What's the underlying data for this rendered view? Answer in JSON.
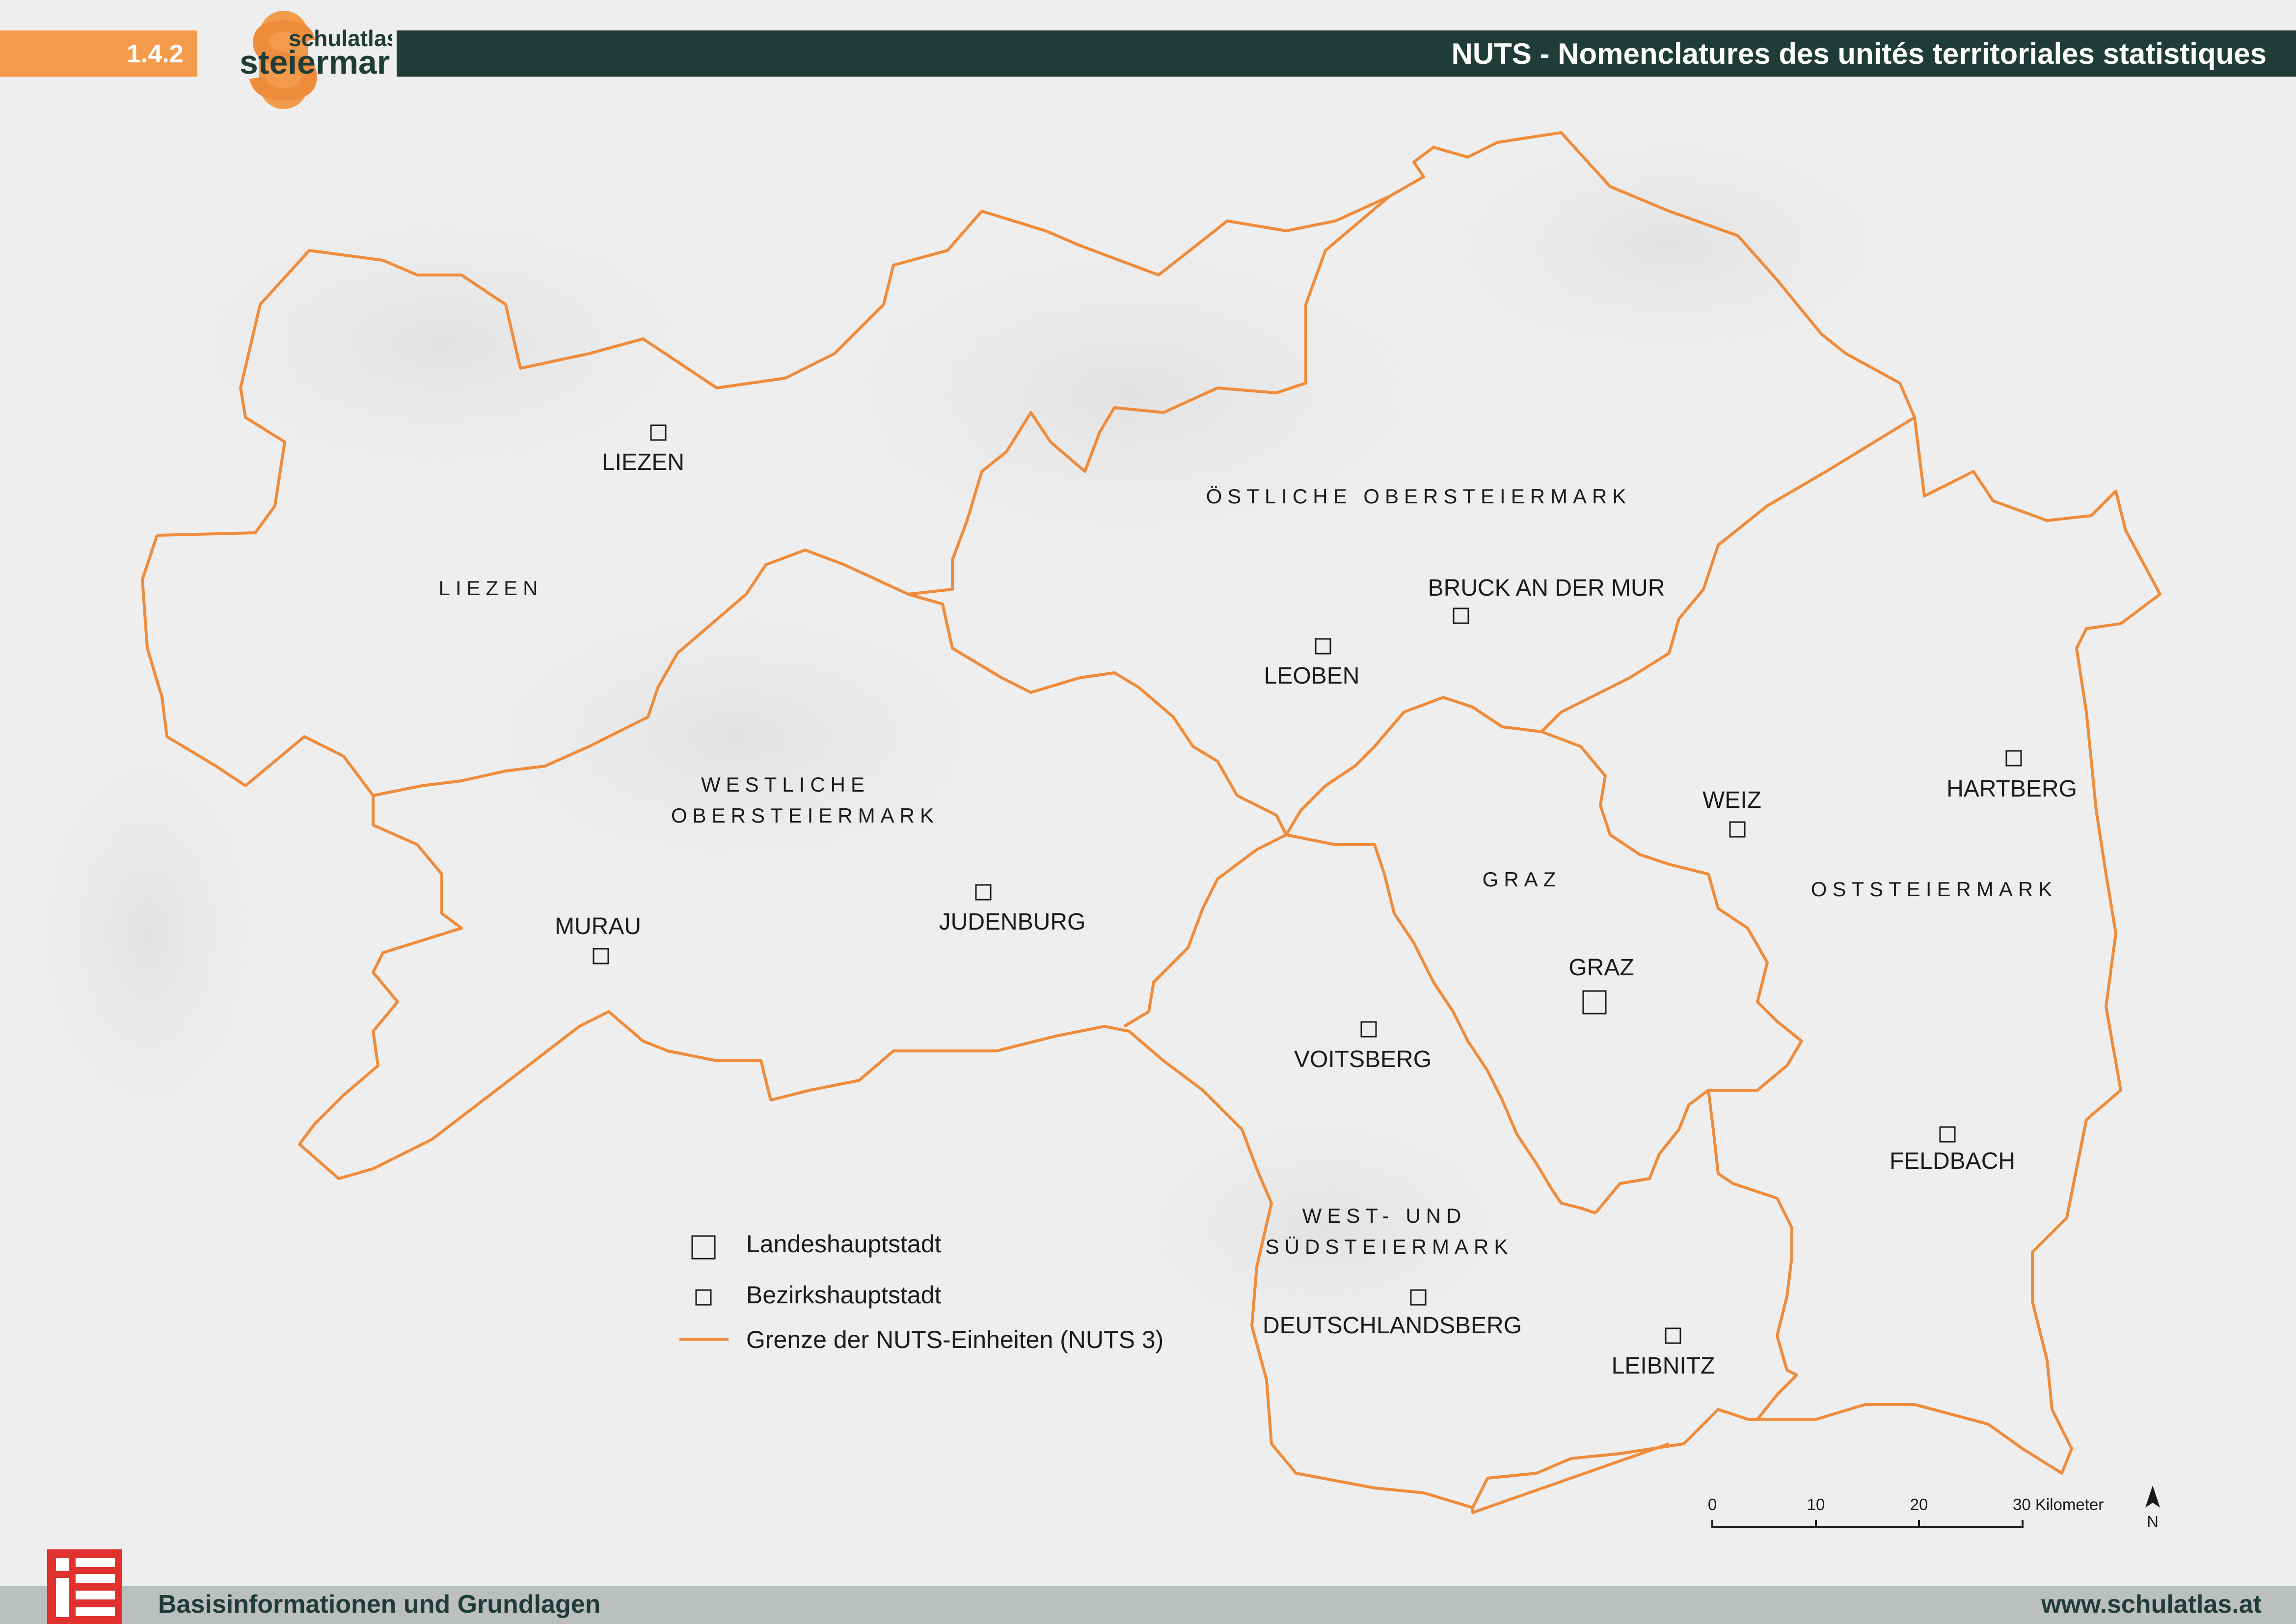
{
  "header": {
    "section_number": "1.4.2",
    "logo_top": "schulatlas",
    "logo_main": "steiermark",
    "title": "NUTS - Nomenclatures des unités territoriales statistiques"
  },
  "footer": {
    "left": "Basisinformationen und Grundlagen",
    "right": "www.schulatlas.at"
  },
  "regions": {
    "liezen": "LIEZEN",
    "oestliche": "ÖSTLICHE OBERSTEIERMARK",
    "westliche_1": "WESTLICHE",
    "westliche_2": "OBERSTEIERMARK",
    "graz": "GRAZ",
    "oststeiermark": "OSTSTEIERMARK",
    "west_sued_1": "WEST- UND",
    "west_sued_2": "SÜDSTEIERMARK"
  },
  "cities": {
    "liezen": "LIEZEN",
    "bruck": "BRUCK AN DER MUR",
    "leoben": "LEOBEN",
    "murau": "MURAU",
    "judenburg": "JUDENBURG",
    "weiz": "WEIZ",
    "hartberg": "HARTBERG",
    "graz": "GRAZ",
    "voitsberg": "VOITSBERG",
    "feldbach": "FELDBACH",
    "deutschlandsberg": "DEUTSCHLANDSBERG",
    "leibnitz": "LEIBNITZ"
  },
  "legend": {
    "capital": "Landeshauptstadt",
    "district": "Bezirkshauptstadt",
    "border": "Grenze der NUTS-Einheiten (NUTS 3)"
  },
  "scale": {
    "t0": "0",
    "t10": "10",
    "t20": "20",
    "t30": "30 Kilometer",
    "north": "N"
  },
  "colors": {
    "border": "#ef8c3c",
    "header_dark": "#1f3d36",
    "header_orange": "#f39a4b",
    "logo_red": "#e0312f"
  }
}
